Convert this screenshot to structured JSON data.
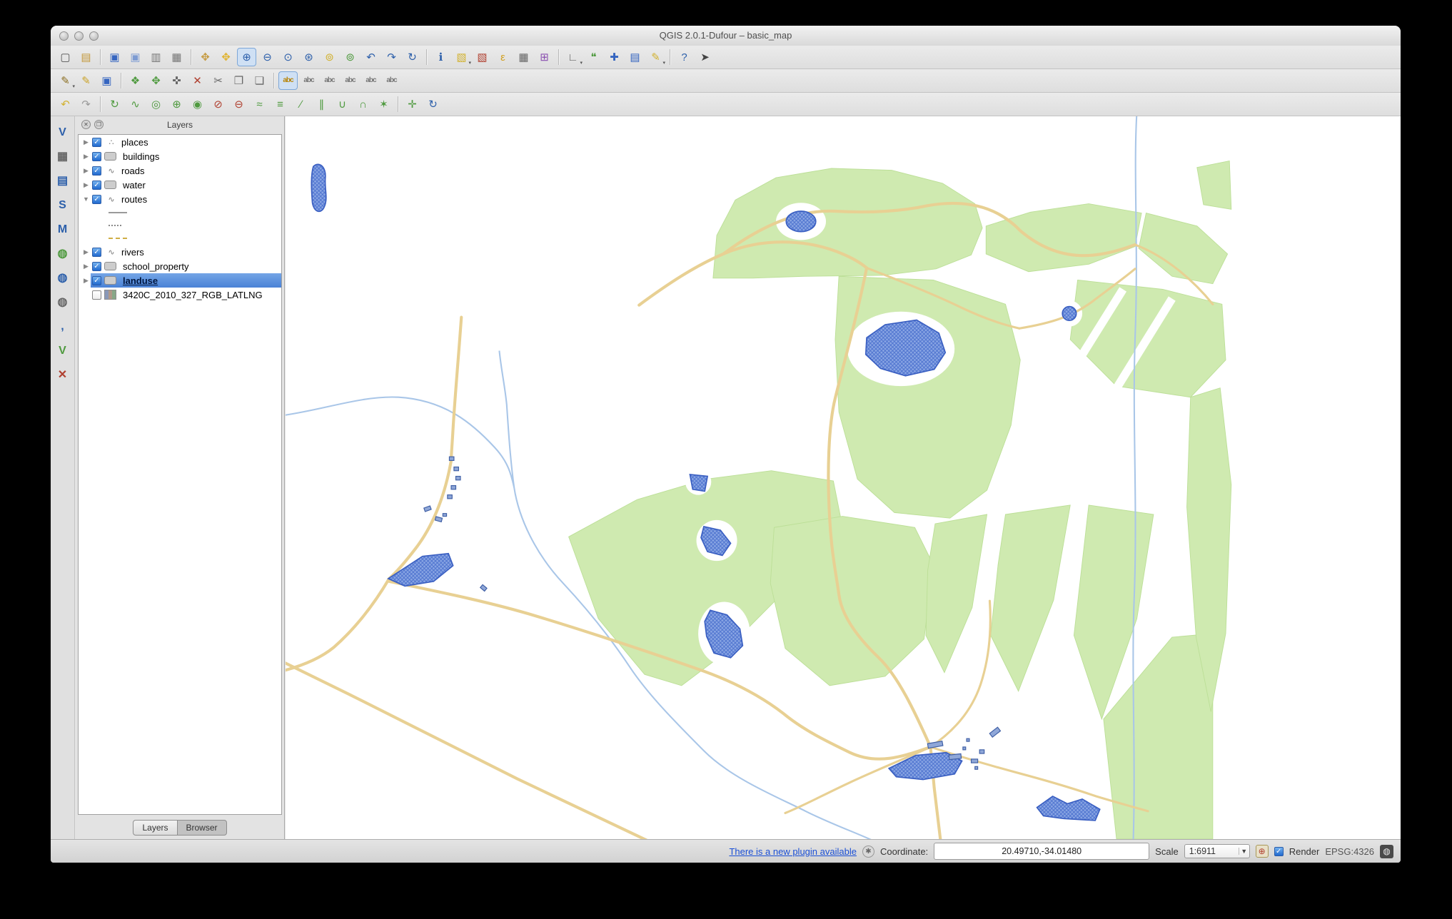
{
  "window": {
    "title": "QGIS 2.0.1-Dufour – basic_map"
  },
  "toolbars": {
    "row1": [
      {
        "name": "new-project-button",
        "glyph": "▢",
        "color": "#555555"
      },
      {
        "name": "open-project-button",
        "glyph": "▤",
        "color": "#c59a3f"
      },
      {
        "sep": true
      },
      {
        "name": "save-project-button",
        "glyph": "▣",
        "color": "#3565c0"
      },
      {
        "name": "save-project-as-button",
        "glyph": "▣",
        "color": "#7d9bd2"
      },
      {
        "name": "new-composer-button",
        "glyph": "▥",
        "color": "#777777"
      },
      {
        "name": "composer-manager-button",
        "glyph": "▦",
        "color": "#777777"
      },
      {
        "sep": true
      },
      {
        "name": "pan-map-button",
        "glyph": "✥",
        "color": "#c59a3f"
      },
      {
        "name": "pan-to-selection-button",
        "glyph": "✥",
        "color": "#e0b32f"
      },
      {
        "name": "zoom-in-button",
        "glyph": "⊕",
        "color": "#2c5faa",
        "active": true
      },
      {
        "name": "zoom-out-button",
        "glyph": "⊖",
        "color": "#2c5faa"
      },
      {
        "name": "zoom-native-button",
        "glyph": "⊙",
        "color": "#2c5faa"
      },
      {
        "name": "zoom-full-button",
        "glyph": "⊛",
        "color": "#2c5faa"
      },
      {
        "name": "zoom-to-selection-button",
        "glyph": "⊚",
        "color": "#d2b230"
      },
      {
        "name": "zoom-to-layer-button",
        "glyph": "⊚",
        "color": "#4f9a3f"
      },
      {
        "name": "zoom-last-button",
        "glyph": "↶",
        "color": "#2c5faa"
      },
      {
        "name": "zoom-next-button",
        "glyph": "↷",
        "color": "#2c5faa"
      },
      {
        "name": "refresh-map-button",
        "glyph": "↻",
        "color": "#2c5faa"
      },
      {
        "sep": true
      },
      {
        "name": "identify-features-button",
        "glyph": "ℹ",
        "color": "#2c5faa"
      },
      {
        "name": "select-features-button",
        "glyph": "▧",
        "color": "#d2b230",
        "caret": true
      },
      {
        "name": "deselect-features-button",
        "glyph": "▧",
        "color": "#b04030"
      },
      {
        "name": "select-by-expression-button",
        "glyph": "ε",
        "color": "#d2a020"
      },
      {
        "name": "open-attribute-table-button",
        "glyph": "▦",
        "color": "#666666"
      },
      {
        "name": "field-calculator-button",
        "glyph": "⊞",
        "color": "#8a4fb0"
      },
      {
        "sep": true
      },
      {
        "name": "measure-button",
        "glyph": "∟",
        "color": "#666666",
        "caret": true
      },
      {
        "name": "map-tips-button",
        "glyph": "❝",
        "color": "#4f9a3f"
      },
      {
        "name": "new-bookmark-button",
        "glyph": "✚",
        "color": "#3565c0"
      },
      {
        "name": "show-bookmarks-button",
        "glyph": "▤",
        "color": "#3565c0"
      },
      {
        "name": "text-annotation-button",
        "glyph": "✎",
        "color": "#d2b230",
        "caret": true
      },
      {
        "sep": true
      },
      {
        "name": "help-contents-button",
        "glyph": "?",
        "color": "#2c5faa"
      },
      {
        "name": "whats-this-button",
        "glyph": "➤",
        "color": "#444444"
      }
    ],
    "row2": [
      {
        "name": "current-edits-button",
        "glyph": "✎",
        "color": "#8a6d1f",
        "caret": true
      },
      {
        "name": "toggle-editing-button",
        "glyph": "✎",
        "color": "#caa227"
      },
      {
        "name": "save-layer-edits-button",
        "glyph": "▣",
        "color": "#3565c0"
      },
      {
        "sep": true
      },
      {
        "name": "add-feature-button",
        "glyph": "❖",
        "color": "#4f9a3f"
      },
      {
        "name": "move-feature-button",
        "glyph": "✥",
        "color": "#4f9a3f"
      },
      {
        "name": "node-tool-button",
        "glyph": "✜",
        "color": "#666666"
      },
      {
        "name": "delete-selected-button",
        "glyph": "✕",
        "color": "#b04030"
      },
      {
        "name": "cut-features-button",
        "glyph": "✂",
        "color": "#666666"
      },
      {
        "name": "copy-features-button",
        "glyph": "❐",
        "color": "#666666"
      },
      {
        "name": "paste-features-button",
        "glyph": "❏",
        "color": "#666666"
      },
      {
        "sep": true
      },
      {
        "name": "layer-labeling-button",
        "glyph": "abc",
        "color": "#b8860b",
        "active": true,
        "small": true
      },
      {
        "name": "label-move-button",
        "glyph": "abc",
        "color": "#777777",
        "small": true
      },
      {
        "name": "label-rotate-button",
        "glyph": "abc",
        "color": "#777777",
        "small": true
      },
      {
        "name": "label-pin-button",
        "glyph": "abc",
        "color": "#777777",
        "small": true
      },
      {
        "name": "label-highlight-button",
        "glyph": "abc",
        "color": "#777777",
        "small": true
      },
      {
        "name": "label-properties-button",
        "glyph": "abc",
        "color": "#777777",
        "small": true
      }
    ],
    "row3": [
      {
        "name": "undo-button",
        "glyph": "↶",
        "color": "#d2b230"
      },
      {
        "name": "redo-button",
        "glyph": "↷",
        "color": "#9a9a9a"
      },
      {
        "sep": true
      },
      {
        "name": "rotate-feature-button",
        "glyph": "↻",
        "color": "#4f9a3f"
      },
      {
        "name": "simplify-feature-button",
        "glyph": "∿",
        "color": "#4f9a3f"
      },
      {
        "name": "add-ring-button",
        "glyph": "◎",
        "color": "#4f9a3f"
      },
      {
        "name": "add-part-button",
        "glyph": "⊕",
        "color": "#4f9a3f"
      },
      {
        "name": "fill-ring-button",
        "glyph": "◉",
        "color": "#4f9a3f"
      },
      {
        "name": "delete-ring-button",
        "glyph": "⊘",
        "color": "#b04030"
      },
      {
        "name": "delete-part-button",
        "glyph": "⊖",
        "color": "#b04030"
      },
      {
        "name": "reshape-features-button",
        "glyph": "≈",
        "color": "#4f9a3f"
      },
      {
        "name": "offset-curve-button",
        "glyph": "≡",
        "color": "#4f9a3f"
      },
      {
        "name": "split-features-button",
        "glyph": "∕",
        "color": "#4f9a3f"
      },
      {
        "name": "split-parts-button",
        "glyph": "∥",
        "color": "#4f9a3f"
      },
      {
        "name": "merge-features-button",
        "glyph": "∪",
        "color": "#4f9a3f"
      },
      {
        "name": "merge-attributes-button",
        "glyph": "∩",
        "color": "#4f9a3f"
      },
      {
        "name": "rotate-point-symbols-button",
        "glyph": "✶",
        "color": "#4f9a3f"
      },
      {
        "sep": true
      },
      {
        "name": "offset-point-symbols-button",
        "glyph": "✛",
        "color": "#4f9a3f"
      },
      {
        "name": "refresh-edits-button",
        "glyph": "↻",
        "color": "#2c5faa"
      }
    ],
    "left": [
      {
        "name": "add-vector-layer-button",
        "glyph": "V",
        "color": "#2c5faa"
      },
      {
        "name": "add-raster-layer-button",
        "glyph": "▦",
        "color": "#666666"
      },
      {
        "name": "add-postgis-layer-button",
        "glyph": "▤",
        "color": "#2c5faa"
      },
      {
        "name": "add-spatialite-layer-button",
        "glyph": "S",
        "color": "#2c5faa"
      },
      {
        "name": "add-mssql-layer-button",
        "glyph": "M",
        "color": "#2c5faa"
      },
      {
        "name": "add-wms-layer-button",
        "glyph": "◍",
        "color": "#4f9a3f"
      },
      {
        "name": "add-wcs-layer-button",
        "glyph": "◍",
        "color": "#2c5faa"
      },
      {
        "name": "add-wfs-layer-button",
        "glyph": "◍",
        "color": "#666666"
      },
      {
        "name": "add-delimited-text-button",
        "glyph": ",",
        "color": "#2c5faa"
      },
      {
        "name": "new-shapefile-layer-button",
        "glyph": "V",
        "color": "#4f9a3f"
      },
      {
        "name": "remove-layer-button",
        "glyph": "✕",
        "color": "#b04030"
      }
    ]
  },
  "layers_panel": {
    "title": "Layers",
    "items": [
      {
        "label": "places",
        "checked": true,
        "expander": "collapsed",
        "icon": "point-layer"
      },
      {
        "label": "buildings",
        "checked": true,
        "expander": "collapsed",
        "icon": "polygon-layer"
      },
      {
        "label": "roads",
        "checked": true,
        "expander": "collapsed",
        "icon": "line-layer"
      },
      {
        "label": "water",
        "checked": true,
        "expander": "collapsed",
        "icon": "polygon-layer"
      },
      {
        "label": "routes",
        "checked": true,
        "expander": "expanded",
        "icon": "line-layer",
        "children": [
          {
            "swatch": "solid-line"
          },
          {
            "swatch": "dotted-line"
          },
          {
            "swatch": "dashed-line"
          }
        ]
      },
      {
        "label": "rivers",
        "checked": true,
        "expander": "collapsed",
        "icon": "line-layer"
      },
      {
        "label": "school_property",
        "checked": true,
        "expander": "collapsed",
        "icon": "polygon-layer"
      },
      {
        "label": "landuse",
        "checked": true,
        "expander": "collapsed",
        "icon": "polygon-layer",
        "selected": true
      },
      {
        "label": "3420C_2010_327_RGB_LATLNG",
        "checked": false,
        "expander": "none",
        "icon": "raster-layer"
      }
    ],
    "tabs": [
      {
        "label": "Layers",
        "active": true
      },
      {
        "label": "Browser",
        "active": false
      }
    ]
  },
  "status_bar": {
    "plugin_link": "There is a new plugin available",
    "coordinate_label": "Coordinate:",
    "coordinate_value": "20.49710,-34.01480",
    "scale_label": "Scale",
    "scale_value": "1:6911",
    "render_label": "Render",
    "crs_label": "EPSG:4326"
  },
  "map": {
    "colors": {
      "landuse": "#cfeab0",
      "landuse_stroke": "#bcdf97",
      "water_fill": "#8aa6e4",
      "water_stroke": "#3a5fc2",
      "road": "#e8d093",
      "river": "#a9c6e8",
      "building": "#8fa7d8",
      "building_stroke": "#3f5fa5"
    }
  }
}
